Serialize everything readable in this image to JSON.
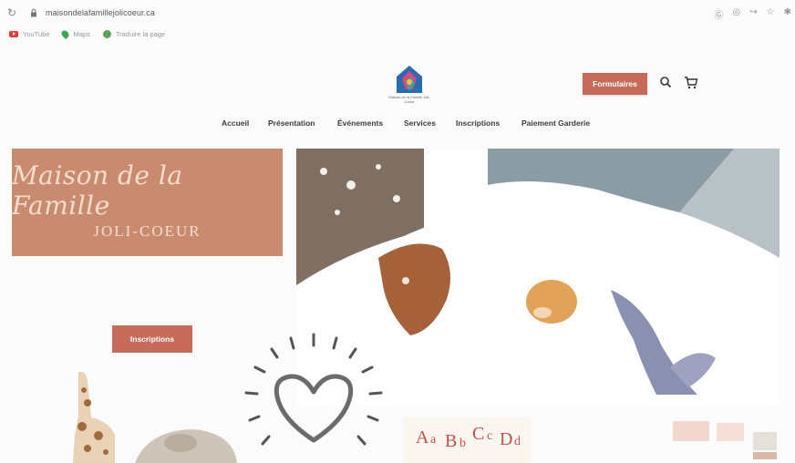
{
  "browser": {
    "url": "maisondelafamillejolicoeur.ca",
    "bookmarks": [
      {
        "label": "YouTube",
        "icon": "youtube-icon"
      },
      {
        "label": "Maps",
        "icon": "maps-icon"
      },
      {
        "label": "Traduire la page",
        "icon": "translate-icon"
      }
    ]
  },
  "header": {
    "logo_caption": "Maison de la Famille Joli-Coeur",
    "formulaires_label": "Formulaires"
  },
  "nav": {
    "items": [
      "Accueil",
      "Présentation",
      "Événements",
      "Services",
      "Inscriptions",
      "Paiement Garderie"
    ]
  },
  "hero": {
    "script_title": "Maison de la Famille",
    "caps_title": "JOLI-COEUR",
    "inscriptions_label": "Inscriptions"
  },
  "colors": {
    "accent": "#c66a5a",
    "banner": "#c98b6f",
    "banner_text": "#f5dccd"
  }
}
